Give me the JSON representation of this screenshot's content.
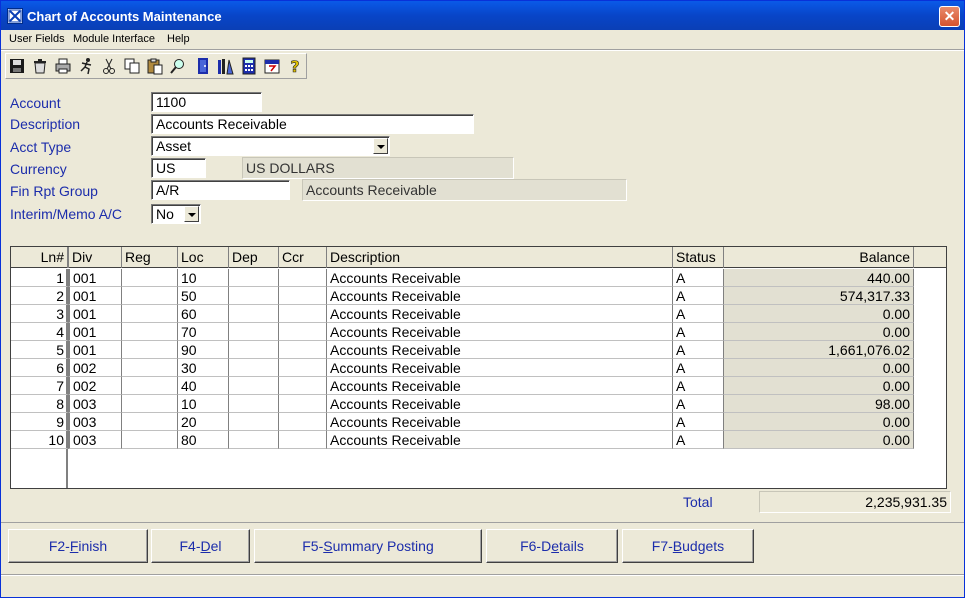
{
  "window": {
    "title": "Chart of Accounts Maintenance",
    "close_label": "✕"
  },
  "menu": [
    "User Fields",
    "Module Interface",
    "Help"
  ],
  "toolbar": {
    "icons": [
      "save-icon",
      "recycle-bin-icon",
      "print-icon",
      "run-icon",
      "cut-icon",
      "copy-icon",
      "paste-icon",
      "find-icon",
      "exit-door-icon",
      "books-icon",
      "calculator-icon",
      "calendar-icon",
      "help-icon"
    ]
  },
  "form": {
    "account": {
      "label": "Account",
      "value": "1100"
    },
    "description": {
      "label": "Description",
      "value": "Accounts Receivable"
    },
    "acct_type": {
      "label": "Acct Type",
      "value": "Asset"
    },
    "currency": {
      "label": "Currency",
      "code": "US",
      "name": "US DOLLARS"
    },
    "fin_rpt_group": {
      "label": "Fin Rpt Group",
      "code": "A/R",
      "name": "Accounts Receivable"
    },
    "interim": {
      "label": "Interim/Memo A/C",
      "value": "No"
    }
  },
  "grid": {
    "columns": [
      "Ln#",
      "Div",
      "Reg",
      "Loc",
      "Dep",
      "Ccr",
      "Description",
      "Status",
      "Balance"
    ],
    "rows": [
      {
        "ln": "1",
        "div": "001",
        "reg": "",
        "loc": "10",
        "dep": "",
        "ccr": "",
        "desc": "Accounts Receivable",
        "status": "A",
        "balance": "440.00"
      },
      {
        "ln": "2",
        "div": "001",
        "reg": "",
        "loc": "50",
        "dep": "",
        "ccr": "",
        "desc": "Accounts Receivable",
        "status": "A",
        "balance": "574,317.33"
      },
      {
        "ln": "3",
        "div": "001",
        "reg": "",
        "loc": "60",
        "dep": "",
        "ccr": "",
        "desc": "Accounts Receivable",
        "status": "A",
        "balance": "0.00"
      },
      {
        "ln": "4",
        "div": "001",
        "reg": "",
        "loc": "70",
        "dep": "",
        "ccr": "",
        "desc": "Accounts Receivable",
        "status": "A",
        "balance": "0.00"
      },
      {
        "ln": "5",
        "div": "001",
        "reg": "",
        "loc": "90",
        "dep": "",
        "ccr": "",
        "desc": "Accounts Receivable",
        "status": "A",
        "balance": "1,661,076.02"
      },
      {
        "ln": "6",
        "div": "002",
        "reg": "",
        "loc": "30",
        "dep": "",
        "ccr": "",
        "desc": "Accounts Receivable",
        "status": "A",
        "balance": "0.00"
      },
      {
        "ln": "7",
        "div": "002",
        "reg": "",
        "loc": "40",
        "dep": "",
        "ccr": "",
        "desc": "Accounts Receivable",
        "status": "A",
        "balance": "0.00"
      },
      {
        "ln": "8",
        "div": "003",
        "reg": "",
        "loc": "10",
        "dep": "",
        "ccr": "",
        "desc": "Accounts Receivable",
        "status": "A",
        "balance": "98.00"
      },
      {
        "ln": "9",
        "div": "003",
        "reg": "",
        "loc": "20",
        "dep": "",
        "ccr": "",
        "desc": "Accounts Receivable",
        "status": "A",
        "balance": "0.00"
      },
      {
        "ln": "10",
        "div": "003",
        "reg": "",
        "loc": "80",
        "dep": "",
        "ccr": "",
        "desc": "Accounts Receivable",
        "status": "A",
        "balance": "0.00"
      }
    ]
  },
  "total": {
    "label": "Total",
    "value": "2,235,931.35"
  },
  "buttons": [
    {
      "pre": "F2-",
      "key": "F",
      "post": "inish"
    },
    {
      "pre": "F4-",
      "key": "D",
      "post": "el"
    },
    {
      "pre": "F5-",
      "key": "S",
      "post": "ummary Posting"
    },
    {
      "pre": "F6-D",
      "key": "e",
      "post": "tails"
    },
    {
      "pre": "F7-",
      "key": "B",
      "post": "udgets"
    }
  ]
}
